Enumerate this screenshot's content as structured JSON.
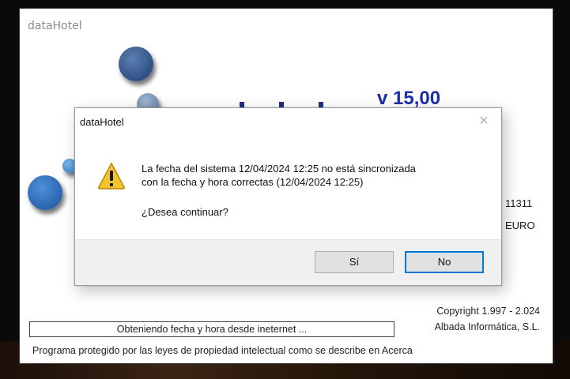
{
  "splash": {
    "app_name": "dataHotel",
    "version_text": "v 15,00",
    "side_number": "11311",
    "side_currency": "EURO",
    "copyright_line1": "Copyright 1.997 - 2.024",
    "copyright_line2": "Albada Informática, S.L.",
    "status_text": "Obteniendo fecha y hora desde ineternet ...",
    "legal_text": "Programa protegido por las leyes de propiedad intelectual como se describe en Acerca"
  },
  "dialog": {
    "title": "dataHotel",
    "close_glyph": "✕",
    "message_line1": "La fecha del sistema 12/04/2024 12:25 no está sincronizada",
    "message_line2": "con la fecha y hora correctas (12/04/2024 12:25)",
    "question": "¿Desea continuar?",
    "yes_label": "Sí",
    "no_label": "No",
    "icon": "warning-icon"
  },
  "colors": {
    "version": "#1c2fa8",
    "focus_border": "#0078d7",
    "warning_fill": "#f4c430"
  }
}
